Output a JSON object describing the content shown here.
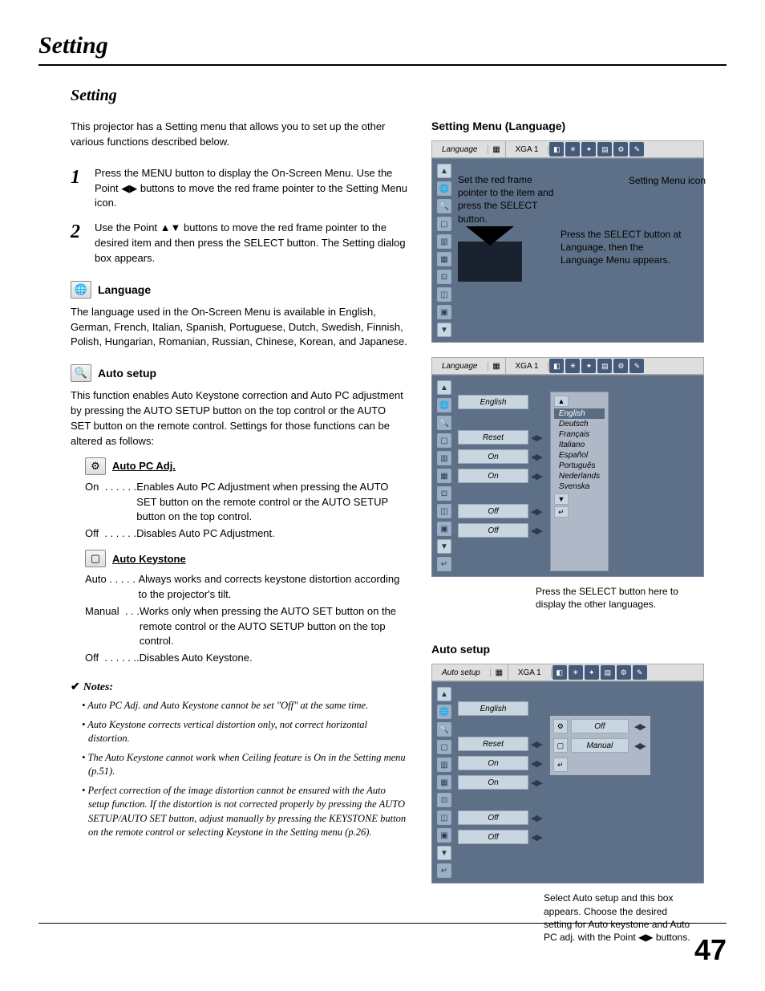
{
  "page": {
    "title": "Setting",
    "section_title": "Setting",
    "page_number": "47"
  },
  "intro": "This projector has a Setting menu that allows you to set up the other various functions described below.",
  "steps": {
    "s1_num": "1",
    "s1_body": "Press the MENU button to display the On-Screen Menu. Use the Point ◀▶ buttons to move the red frame pointer to the Setting Menu icon.",
    "s2_num": "2",
    "s2_body": "Use the Point ▲▼ buttons to move the red frame pointer to the desired item and then press the SELECT button. The Setting dialog box appears."
  },
  "language": {
    "head": "Language",
    "body": "The language used in the On-Screen Menu is available in English, German, French, Italian, Spanish, Portuguese, Dutch, Swedish, Finnish, Polish, Hungarian, Romanian, Russian, Chinese, Korean, and Japanese."
  },
  "autosetup": {
    "head": "Auto setup",
    "body": "This function enables Auto Keystone correction and Auto PC adjustment by pressing the AUTO SETUP button on the top control or the AUTO SET button on the remote control. Settings for those functions can be altered as follows:"
  },
  "autopc": {
    "head": "Auto PC Adj.",
    "on_label": "On  . . . . . .",
    "on_desc": "Enables Auto PC Adjustment when pressing the AUTO SET button on the remote control or the AUTO SETUP button on the top control.",
    "off_label": "Off  . . . . . .",
    "off_desc": "Disables Auto PC Adjustment."
  },
  "autokey": {
    "head": "Auto Keystone",
    "auto_label": "Auto . . . . . ",
    "auto_desc": "Always works and corrects keystone distortion according to the projector's tilt.",
    "manual_label": "Manual  . . .",
    "manual_desc": "Works only when pressing the AUTO SET button on the remote control or the AUTO SETUP button on the top control.",
    "off_label": "Off  . . . . . ..",
    "off_desc": "Disables Auto Keystone."
  },
  "notes": {
    "head": "Notes:",
    "n1": "Auto PC Adj. and Auto Keystone cannot be set \"Off\" at the same time.",
    "n2": "Auto Keystone corrects vertical distortion only, not correct horizontal distortion.",
    "n3": "The Auto Keystone cannot work when Ceiling feature is On in the Setting menu (p.51).",
    "n4": "Perfect correction of the image distortion cannot be ensured with the Auto setup function. If the distortion is not corrected properly by pressing the AUTO SETUP/AUTO SET button, adjust manually by pressing the KEYSTONE button on the remote control or selecting Keystone in the Setting menu (p.26)."
  },
  "osd1": {
    "title": "Setting Menu (Language)",
    "topbar_label": "Language",
    "topbar_mode": "XGA 1",
    "callout_icon": "Setting Menu icon",
    "callout_frame": "Set the red frame pointer to the item and press the SELECT button.",
    "callout_select": "Press the SELECT button at Language, then the Language Menu appears."
  },
  "osd2": {
    "topbar_label": "Language",
    "topbar_mode": "XGA 1",
    "values": {
      "lang": "English",
      "reset": "Reset",
      "on1": "On",
      "on2": "On",
      "off1": "Off",
      "off2": "Off"
    },
    "lang_list": [
      "English",
      "Deutsch",
      "Français",
      "Italiano",
      "Español",
      "Português",
      "Nederlands",
      "Svenska"
    ],
    "callout_below": "Press the SELECT button here to display the other languages."
  },
  "osd3": {
    "title": "Auto setup",
    "topbar_label": "Auto setup",
    "topbar_mode": "XGA 1",
    "values": {
      "lang": "English",
      "reset": "Reset",
      "on1": "On",
      "on2": "On",
      "off1": "Off",
      "off2": "Off",
      "right_off": "Off",
      "right_manual": "Manual"
    },
    "callout": "Select Auto setup and this box appears. Choose the desired setting for Auto keystone and Auto PC adj. with the Point ◀▶ buttons."
  }
}
